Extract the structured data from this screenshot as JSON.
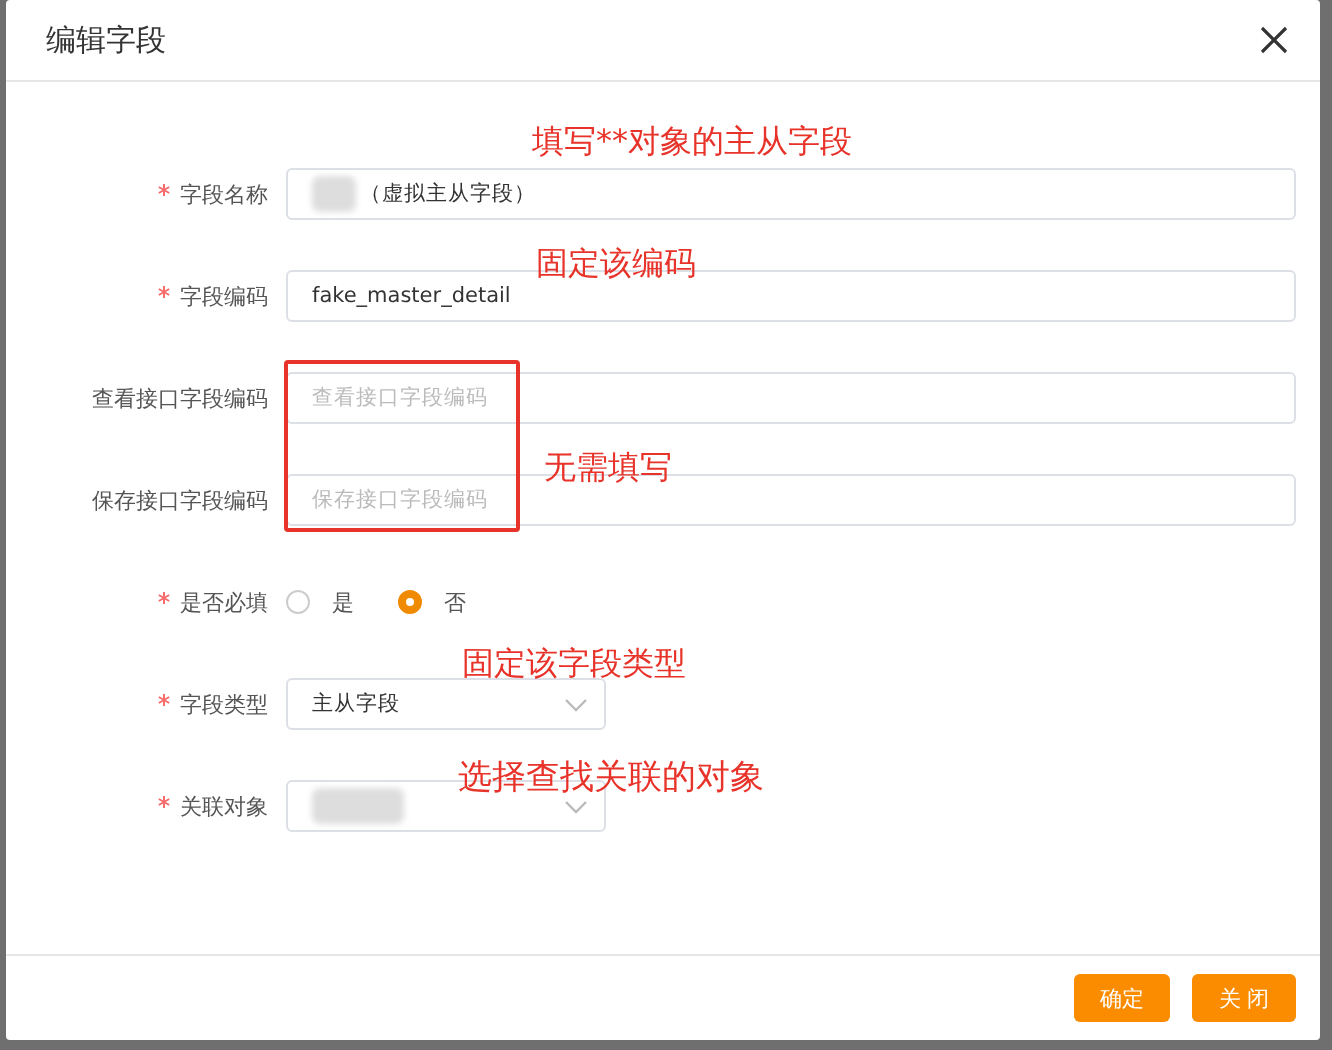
{
  "dialog": {
    "title": "编辑字段"
  },
  "fields": [
    {
      "kind": "input",
      "required": true,
      "label": "字段名称",
      "value": "（虚拟主从字段）",
      "redacted": true
    },
    {
      "kind": "input",
      "required": true,
      "label": "字段编码",
      "value": "fake_master_detail"
    },
    {
      "kind": "input",
      "required": false,
      "label": "查看接口字段编码",
      "placeholder": "查看接口字段编码"
    },
    {
      "kind": "input",
      "required": false,
      "label": "保存接口字段编码",
      "placeholder": "保存接口字段编码"
    },
    {
      "kind": "radio",
      "required": true,
      "label": "是否必填",
      "options": [
        {
          "label": "是",
          "selected": false
        },
        {
          "label": "否",
          "selected": true
        }
      ]
    },
    {
      "kind": "select",
      "required": true,
      "label": "字段类型",
      "value": "主从字段"
    },
    {
      "kind": "select",
      "required": true,
      "label": "关联对象",
      "redacted": true
    }
  ],
  "annotations": [
    {
      "kind": "text",
      "text": "填写**对象的主从字段"
    },
    {
      "kind": "text",
      "text": "固定该编码"
    },
    {
      "kind": "frame"
    },
    {
      "kind": "text",
      "text": "无需填写"
    },
    {
      "kind": "text",
      "text": "固定该字段类型"
    },
    {
      "kind": "text",
      "text": "选择查找关联的对象"
    }
  ],
  "buttons": [
    "确定",
    "关 闭"
  ]
}
